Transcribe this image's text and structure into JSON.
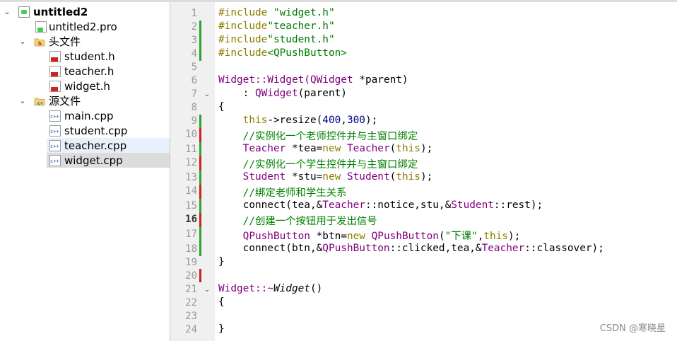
{
  "project_tree": {
    "project": "untitled2",
    "pro_file": "untitled2.pro",
    "headers_folder": "头文件",
    "headers": [
      "student.h",
      "teacher.h",
      "widget.h"
    ],
    "sources_folder": "源文件",
    "sources": [
      "main.cpp",
      "student.cpp",
      "teacher.cpp",
      "widget.cpp"
    ],
    "hovered": "teacher.cpp",
    "selected": "widget.cpp"
  },
  "editor": {
    "current_line": 16,
    "line_numbers": [
      "1",
      "2",
      "3",
      "4",
      "5",
      "6",
      "7",
      "8",
      "9",
      "10",
      "11",
      "12",
      "13",
      "14",
      "15",
      "16",
      "17",
      "18",
      "19",
      "20",
      "21",
      "22",
      "23",
      "24"
    ],
    "text": {
      "l1_pp": "#include ",
      "l1_str": "\"widget.h\"",
      "l2_pp": "#include",
      "l2_str": "\"teacher.h\"",
      "l3_pp": "#include",
      "l3_str": "\"student.h\"",
      "l4_pp": "#include",
      "l4_str": "<QPushButton>",
      "l6_a": "Widget::Widget(",
      "l6_b": "QWidget",
      "l6_c": " *parent)",
      "l7_a": "    : ",
      "l7_b": "QWidget",
      "l7_c": "(parent)",
      "l8": "{",
      "l9_a": "    ",
      "l9_b": "this",
      "l9_c": "->resize(",
      "l9_d": "400",
      "l9_e": ",",
      "l9_f": "300",
      "l9_g": ");",
      "l10": "    //实例化一个老师控件并与主窗口绑定",
      "l11_a": "    ",
      "l11_b": "Teacher",
      "l11_c": " *tea=",
      "l11_d": "new",
      "l11_e": " ",
      "l11_f": "Teacher",
      "l11_g": "(",
      "l11_h": "this",
      "l11_i": ");",
      "l12": "    //实例化一个学生控件并与主窗口绑定",
      "l13_a": "    ",
      "l13_b": "Student",
      "l13_c": " *stu=",
      "l13_d": "new",
      "l13_e": " ",
      "l13_f": "Student",
      "l13_g": "(",
      "l13_h": "this",
      "l13_i": ");",
      "l14": "    //绑定老师和学生关系",
      "l15_a": "    connect(tea,&",
      "l15_b": "Teacher",
      "l15_c": "::notice,stu,&",
      "l15_d": "Student",
      "l15_e": "::rest);",
      "l16": "    //创建一个按钮用于发出信号",
      "l17_a": "    ",
      "l17_b": "QPushButton",
      "l17_c": " *btn=",
      "l17_d": "new",
      "l17_e": " ",
      "l17_f": "QPushButton",
      "l17_g": "(",
      "l17_h": "\"下课\"",
      "l17_i": ",",
      "l17_j": "this",
      "l17_k": ");",
      "l18_a": "    connect(btn,&",
      "l18_b": "QPushButton",
      "l18_c": "::clicked,tea,&",
      "l18_d": "Teacher",
      "l18_e": "::classover);",
      "l19": "}",
      "l21_a": "Widget::~",
      "l21_b": "Widget",
      "l21_c": "()",
      "l22": "{",
      "l24": "}"
    }
  },
  "watermark": "CSDN @寒晓星",
  "colors": {
    "keyword": "#8b7e00",
    "string": "#007a00",
    "type": "#800080",
    "comment": "#008000",
    "number": "#00008b",
    "change_green": "#2aa52a",
    "change_red": "#d02020"
  }
}
